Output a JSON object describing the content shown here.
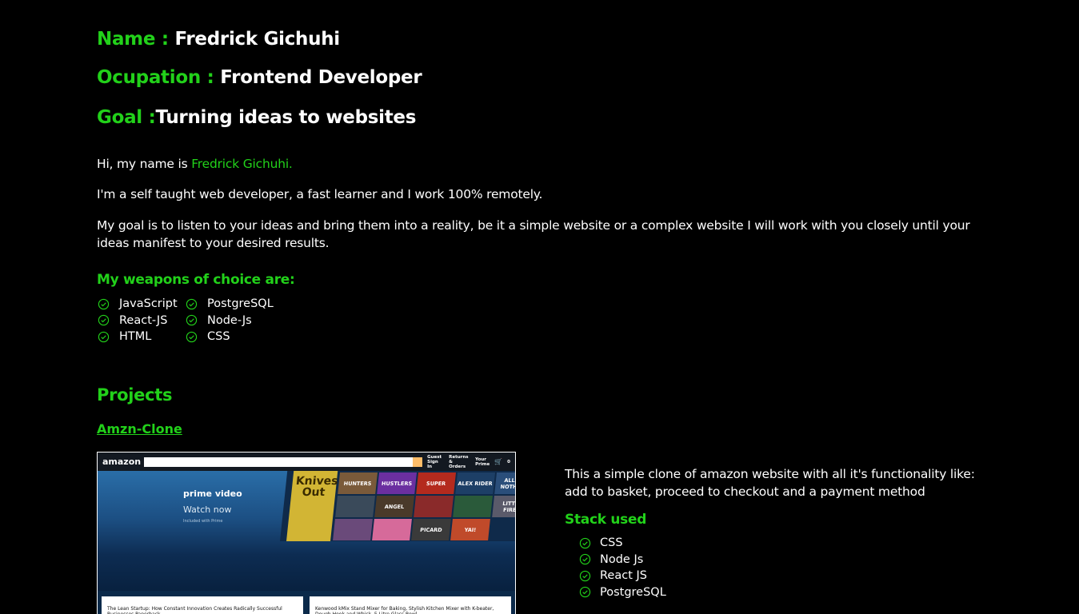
{
  "header": {
    "name_label": "Name : ",
    "name_value": "Fredrick Gichuhi",
    "occupation_label": "Ocupation : ",
    "occupation_value": "Frontend Developer",
    "goal_label": "Goal :",
    "goal_value": "Turning ideas to websites"
  },
  "about": {
    "intro_prefix": "Hi, my name is ",
    "intro_name": "Fredrick Gichuhi.",
    "line2": "I'm a self taught web developer, a fast learner and I work 100% remotely.",
    "line3": "My goal is to listen to your ideas and bring them into a reality, be it a simple website or a complex website I will work with you closely until your ideas manifest to your desired results."
  },
  "weapons": {
    "title": "My weapons of choice are:",
    "col1": [
      "JavaScript",
      "React-JS",
      "HTML"
    ],
    "col2": [
      "PostgreSQL",
      "Node-Js",
      "CSS"
    ]
  },
  "projects": {
    "title": "Projects",
    "items": [
      {
        "name": "Amzn-Clone",
        "description": "This a simple clone of amazon website with all it's functionality like: add to basket, proceed to checkout and a payment method",
        "stack_title": "Stack used",
        "stack": [
          "CSS",
          "Node Js",
          "React JS",
          "PostgreSQL"
        ],
        "screenshot": {
          "logo": "amazon",
          "nav_guest": "Guest",
          "nav_signin": "Sign In",
          "nav_returns": "Returns",
          "nav_orders": "& Orders",
          "nav_your": "Your",
          "nav_prime": "Prime",
          "nav_cart_count": "0",
          "hero_title": "prime video",
          "hero_watch": "Watch now",
          "hero_included": "Included with Prime",
          "tile_knives": "Knives Out",
          "tiles": [
            "HUNTERS",
            "HUSTLERS",
            "SUPER",
            "ALEX RIDER",
            "ALL OR NOTHING",
            "",
            "ANGEL",
            "",
            "",
            "LITTLE FIRES",
            "",
            "",
            "PICARD",
            "YAI!"
          ],
          "card1": "The Lean Startup: How Constant Innovation Creates Radically Successful Businesses Paperback",
          "card2": "Kenwood kMix Stand Mixer for Baking, Stylish Kitchen Mixer with K-beater, Dough Hook and Whisk, 5 Litre Glass Bowl"
        }
      }
    ]
  },
  "colors": {
    "accent": "#22d11a",
    "background": "#000000",
    "text": "#ffffff"
  },
  "icons": {
    "list_bullet": "check-circle-icon"
  }
}
